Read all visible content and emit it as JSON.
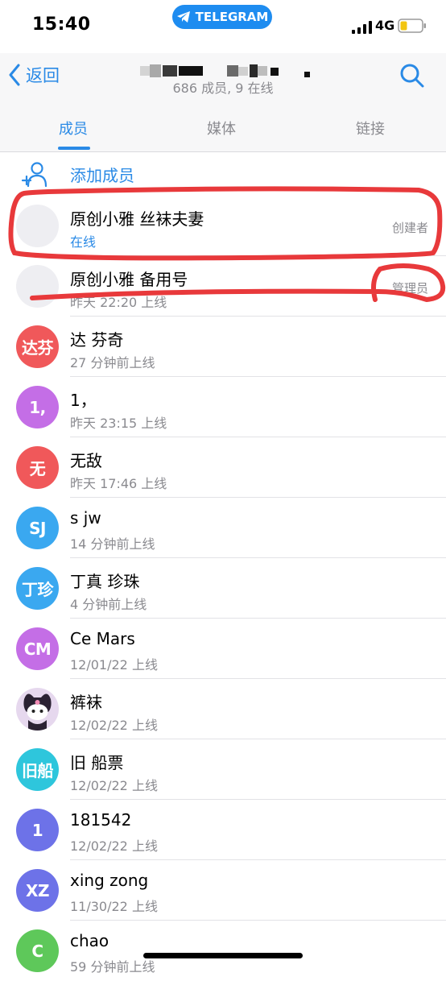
{
  "status_bar": {
    "time": "15:40",
    "app_pill": "TELEGRAM",
    "network": "4G"
  },
  "header": {
    "back_label": "返回",
    "subtitle": "686 成员, 9 在线",
    "tabs": [
      {
        "label": "成员",
        "active": true
      },
      {
        "label": "媒体",
        "active": false
      },
      {
        "label": "链接",
        "active": false
      }
    ]
  },
  "add_member_label": "添加成员",
  "members": [
    {
      "name": "原创小雅 丝袜夫妻",
      "status": "在线",
      "online": true,
      "role": "创建者",
      "avatar_text": "",
      "avatar_color": "#eeeef2"
    },
    {
      "name": "原创小雅 备用号",
      "status": "昨天 22:20 上线",
      "online": false,
      "role": "管理员",
      "avatar_text": "",
      "avatar_color": "#eeeef2"
    },
    {
      "name": "达 芬奇",
      "status": "27 分钟前上线",
      "online": false,
      "role": "",
      "avatar_text": "达芬",
      "avatar_color": "#f0585a"
    },
    {
      "name": "1，",
      "status": "昨天 23:15 上线",
      "online": false,
      "role": "",
      "avatar_text": "1,",
      "avatar_color": "#c46ee6"
    },
    {
      "name": "无敌",
      "status": "昨天 17:46 上线",
      "online": false,
      "role": "",
      "avatar_text": "无",
      "avatar_color": "#f0585a"
    },
    {
      "name": "s jw",
      "status": "14 分钟前上线",
      "online": false,
      "role": "",
      "avatar_text": "SJ",
      "avatar_color": "#3aa8f0"
    },
    {
      "name": "丁真 珍珠",
      "status": "4 分钟前上线",
      "online": false,
      "role": "",
      "avatar_text": "丁珍",
      "avatar_color": "#3aa8f0"
    },
    {
      "name": "Ce Mars",
      "status": "12/01/22 上线",
      "online": false,
      "role": "",
      "avatar_text": "CM",
      "avatar_color": "#c46ee6"
    },
    {
      "name": "裤袜",
      "status": "12/02/22 上线",
      "online": false,
      "role": "",
      "avatar_text": "",
      "avatar_color": "#d9c6e6"
    },
    {
      "name": "旧 船票",
      "status": "12/02/22 上线",
      "online": false,
      "role": "",
      "avatar_text": "旧船",
      "avatar_color": "#2ec6dc"
    },
    {
      "name": "181542",
      "status": "12/02/22 上线",
      "online": false,
      "role": "",
      "avatar_text": "1",
      "avatar_color": "#6d72e8"
    },
    {
      "name": "xing zong",
      "status": "11/30/22 上线",
      "online": false,
      "role": "",
      "avatar_text": "XZ",
      "avatar_color": "#6d72e8"
    },
    {
      "name": "chao",
      "status": "59 分钟前上线",
      "online": false,
      "role": "",
      "avatar_text": "C",
      "avatar_color": "#5ec85a"
    }
  ]
}
